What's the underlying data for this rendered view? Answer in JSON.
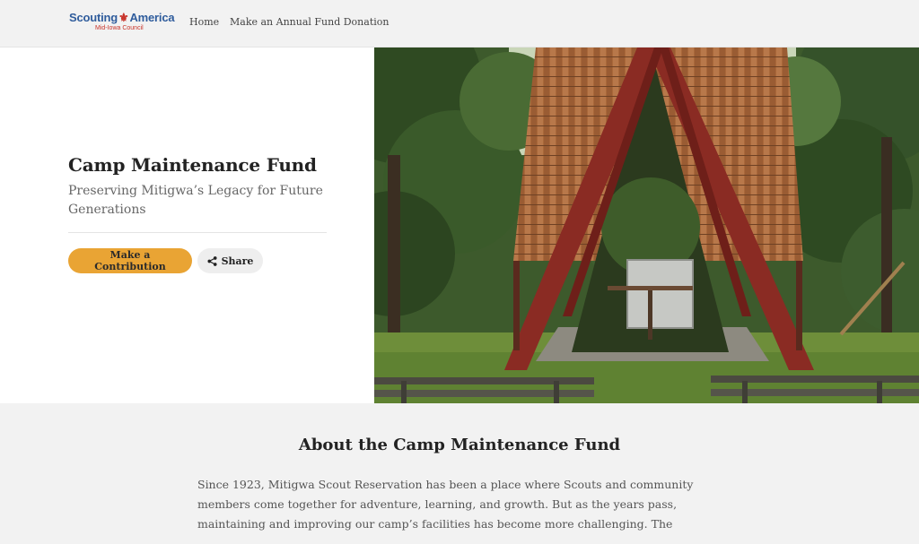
{
  "header": {
    "logo": {
      "brand_left": "Scouting",
      "brand_right": "America",
      "council": "Mid-Iowa Council"
    },
    "nav": {
      "home": "Home",
      "donate": "Make an Annual Fund Donation"
    }
  },
  "hero": {
    "title": "Camp Maintenance Fund",
    "subtitle": "Preserving Mitigwa’s Legacy for Future Generations",
    "contribute_label": "Make a Contribution",
    "share_label": "Share",
    "share_icon": "share-icon",
    "image_subject": "A-frame-shelter"
  },
  "about": {
    "heading": "About the Camp Maintenance Fund",
    "text": "Since 1923, Mitigwa Scout Reservation has been a place where Scouts and community members come together for adventure, learning, and growth. But as the years pass, maintaining and improving our camp’s facilities has become more challenging. The"
  },
  "colors": {
    "accent": "#e9a434",
    "brand_blue": "#2f5c9c",
    "brand_red": "#c8342b"
  }
}
